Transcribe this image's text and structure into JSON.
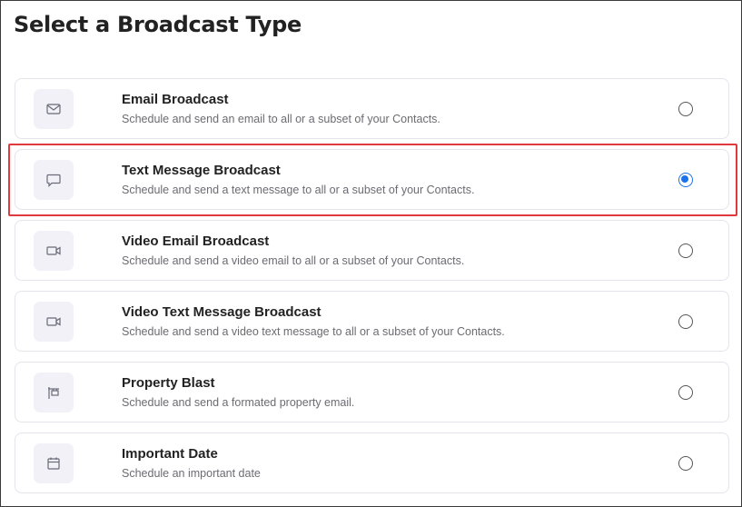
{
  "page": {
    "title": "Select a Broadcast Type"
  },
  "options": [
    {
      "name": "Email Broadcast",
      "description": "Schedule and send an email to all or a subset of your Contacts.",
      "icon": "envelope-icon",
      "selected": false
    },
    {
      "name": "Text Message Broadcast",
      "description": "Schedule and send a text message to all or a subset of your Contacts.",
      "icon": "chat-bubble-icon",
      "selected": true
    },
    {
      "name": "Video Email Broadcast",
      "description": "Schedule and send a video email to all or a subset of your Contacts.",
      "icon": "video-camera-icon",
      "selected": false
    },
    {
      "name": "Video Text Message Broadcast",
      "description": "Schedule and send a video text message to all or a subset of your Contacts.",
      "icon": "video-camera-icon",
      "selected": false
    },
    {
      "name": "Property Blast",
      "description": "Schedule and send a formated property email.",
      "icon": "property-sign-icon",
      "selected": false
    },
    {
      "name": "Important Date",
      "description": "Schedule an important date",
      "icon": "calendar-icon",
      "selected": false
    }
  ],
  "colors": {
    "accent": "#1a73e8",
    "highlight": "#e0393e",
    "icon_bg": "#f1f1f7"
  }
}
